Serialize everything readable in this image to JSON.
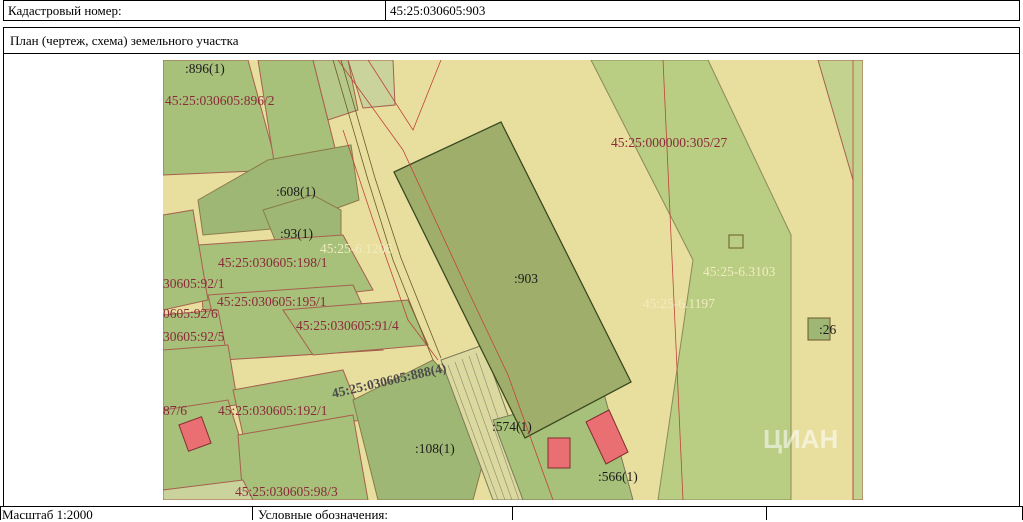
{
  "header": {
    "cadastral_label": "Кадастровый номер:",
    "cadastral_value": "45:25:030605:903"
  },
  "section_title": "План (чертеж, схема) земельного участка",
  "map": {
    "labels": {
      "l896_1": ":896(1)",
      "l896_2": "45:25:030605:896/2",
      "l305_27": "45:25:000000:305/27",
      "l608": ":608(1)",
      "l93": ":93(1)",
      "l6_1206": "45:25-6.1206",
      "l198": "45:25:030605:198/1",
      "l92_1": "30605:92/1",
      "l195": "45:25:030605:195/1",
      "l92_6": "0605:92/6",
      "l91_4": "45:25:030605:91/4",
      "l92_5": "30605:92/5",
      "l903": ":903",
      "l6_3103": "45:25-6.3103",
      "l6_1197": "45:25-6.1197",
      "l26": ":26",
      "l888": "45:25:030605:888(4)",
      "l87_6": "87/6",
      "l192": "45:25:030605:192/1",
      "l574": ":574(1)",
      "l108": ":108(1)",
      "l566": ":566(1)",
      "l98_3": "45:25:030605:98/3"
    },
    "watermark": "ЦИАН"
  },
  "footer": {
    "scale": "Масштаб 1:2000",
    "legend": "Условные обозначения:"
  }
}
